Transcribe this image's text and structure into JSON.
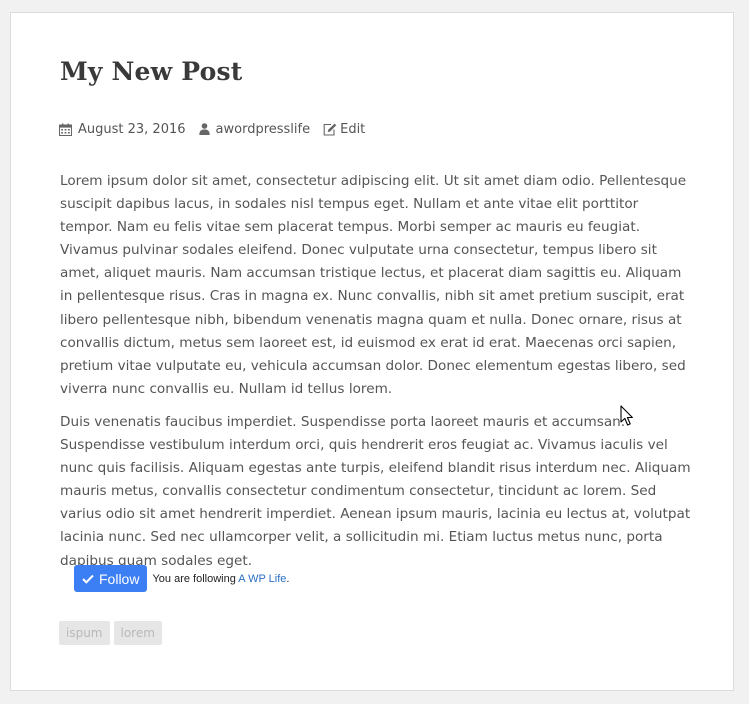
{
  "post": {
    "title": "My New Post",
    "meta": {
      "date": "August 23, 2016",
      "author": "awordpresslife",
      "edit_label": "Edit"
    },
    "paragraphs": [
      "Lorem ipsum dolor sit amet, consectetur adipiscing elit. Ut sit amet diam odio. Pellentesque suscipit dapibus lacus, in sodales nisl tempus eget. Nullam et ante vitae elit porttitor tempor. Nam eu felis vitae sem placerat tempus. Morbi semper ac mauris eu feugiat. Vivamus pulvinar sodales eleifend. Donec vulputate urna consectetur, tempus libero sit amet, aliquet mauris. Nam accumsan tristique lectus, et placerat diam sagittis eu. Aliquam in pellentesque risus. Cras in magna ex. Nunc convallis, nibh sit amet pretium suscipit, erat libero pellentesque nibh, bibendum venenatis magna quam et nulla. Donec ornare, risus at convallis dictum, metus sem laoreet est, id euismod ex erat id erat. Maecenas orci sapien, pretium vitae vulputate eu, vehicula accumsan dolor. Donec elementum egestas libero, sed viverra nunc convallis eu. Nullam id tellus lorem.",
      "Duis venenatis faucibus imperdiet. Suspendisse porta laoreet mauris et accumsan. Suspendisse vestibulum interdum orci, quis hendrerit eros feugiat ac. Vivamus iaculis vel nunc quis facilisis. Aliquam egestas ante turpis, eleifend blandit risus interdum nec. Aliquam mauris metus, convallis consectetur condimentum consectetur, tincidunt ac lorem. Sed varius odio sit amet hendrerit imperdiet. Aenean ipsum mauris, lacinia eu lectus at, volutpat lacinia nunc. Sed nec ullamcorper velit, a sollicitudin mi. Etiam luctus metus nunc, porta dapibus quam sodales eget."
    ],
    "follow": {
      "button_label": "Follow",
      "status_text": "You are following ",
      "site_link": "A WP Life",
      "suffix": "."
    },
    "tags": [
      "ispum",
      "lorem"
    ]
  },
  "icons": {
    "date": "calendar-icon",
    "author": "user-icon",
    "edit": "edit-icon",
    "follow": "checkmark-icon",
    "cursor": "mouse-pointer-icon"
  },
  "colors": {
    "page_background": "#f1f1f1",
    "card_background": "#ffffff",
    "title": "#3a3a3a",
    "body_text": "#555555",
    "follow_button": "#3c7ef3",
    "link": "#2a6fc4",
    "tag_background": "#e6e6e6",
    "tag_text": "#b8b8b8"
  }
}
